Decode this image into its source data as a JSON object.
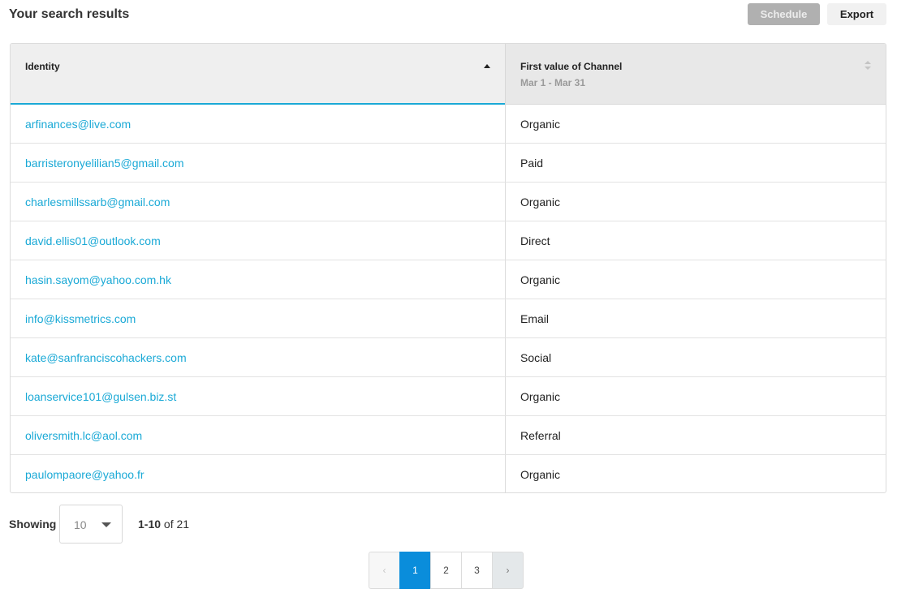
{
  "header": {
    "title": "Your search results",
    "schedule_label": "Schedule",
    "export_label": "Export"
  },
  "table": {
    "columns": [
      {
        "label": "Identity",
        "sub": ""
      },
      {
        "label": "First value of Channel",
        "sub": "Mar 1 - Mar 31"
      }
    ],
    "rows": [
      {
        "identity": "arfinances@live.com",
        "channel": "Organic"
      },
      {
        "identity": "barristeronyelilian5@gmail.com",
        "channel": "Paid"
      },
      {
        "identity": "charlesmillssarb@gmail.com",
        "channel": "Organic"
      },
      {
        "identity": "david.ellis01@outlook.com",
        "channel": "Direct"
      },
      {
        "identity": "hasin.sayom@yahoo.com.hk",
        "channel": "Organic"
      },
      {
        "identity": "info@kissmetrics.com",
        "channel": "Email"
      },
      {
        "identity": "kate@sanfranciscohackers.com",
        "channel": "Social"
      },
      {
        "identity": "loanservice101@gulsen.biz.st",
        "channel": "Organic"
      },
      {
        "identity": "oliversmith.lc@aol.com",
        "channel": "Referral"
      },
      {
        "identity": "paulompaore@yahoo.fr",
        "channel": "Organic"
      }
    ]
  },
  "footer": {
    "showing_label": "Showing",
    "page_size": "10",
    "range": "1-10",
    "of_label": "of",
    "total": "21"
  },
  "pagination": {
    "prev": "‹",
    "pages": [
      "1",
      "2",
      "3"
    ],
    "next": "›",
    "current": "1"
  },
  "colors": {
    "link": "#1aa9d6",
    "active_page": "#0a8ddb"
  }
}
